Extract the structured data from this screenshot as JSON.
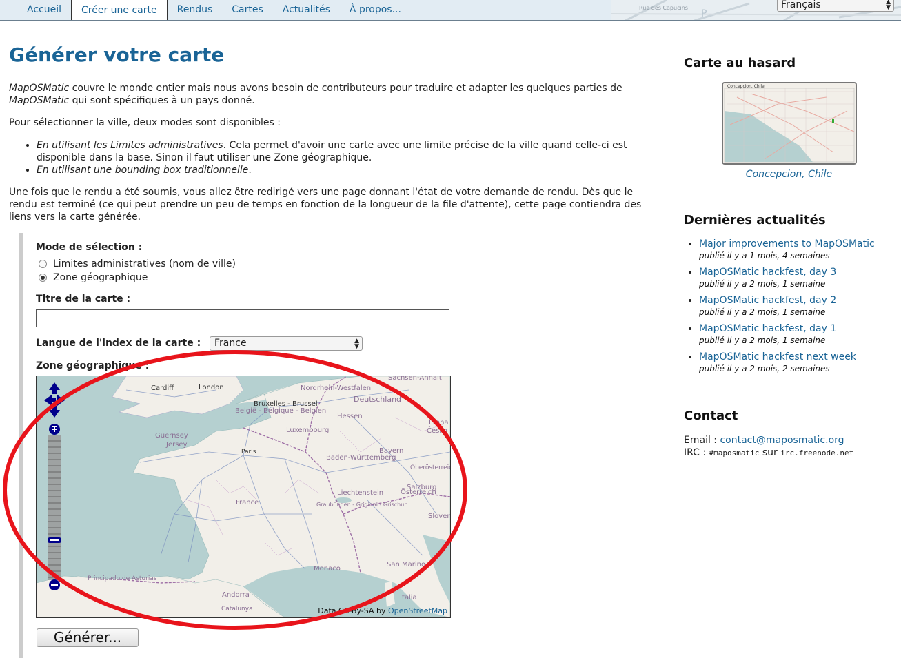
{
  "nav": {
    "tabs": [
      {
        "label": "Accueil"
      },
      {
        "label": "Créer une carte",
        "active": true
      },
      {
        "label": "Rendus"
      },
      {
        "label": "Cartes"
      },
      {
        "label": "Actualités"
      },
      {
        "label": "À propos..."
      }
    ],
    "language": "Français",
    "map_street_label": "Rue des Capucins"
  },
  "main": {
    "title": "Générer votre carte",
    "intro1_em": "MapOSMatic",
    "intro1_text": " couvre le monde entier mais nous avons besoin de contributeurs pour traduire et adapter les quelques parties de ",
    "intro1_em2": "MapOSMatic",
    "intro1_end": " qui sont spécifiques à un pays donné.",
    "intro2": "Pour sélectionner la ville, deux modes sont disponibles :",
    "mode1_em": "En utilisant les Limites administratives",
    "mode1_text": ". Cela permet d'avoir une carte avec une limite précise de la ville quand celle-ci est disponible dans la base. Sinon il faut utiliser une Zone géographique.",
    "mode2_em": "En utilisant une bounding box traditionnelle",
    "mode2_text": ".",
    "intro3": "Une fois que le rendu a été soumis, vous allez être redirigé vers une page donnant l'état de votre demande de rendu. Dès que le rendu est terminé (ce qui peut prendre un peu de temps en fonction de la longueur de la file d'attente), cette page contiendra des liens vers la carte générée."
  },
  "form": {
    "mode_label": "Mode de sélection :",
    "radio_admin": "Limites administratives (nom de ville)",
    "radio_zone": "Zone géographique",
    "selected_mode": "zone",
    "title_label": "Titre de la carte :",
    "title_value": "",
    "index_label": "Langue de l'index de la carte :",
    "index_value": "France",
    "zone_label": "Zone géographique :",
    "submit": "Générer..."
  },
  "map": {
    "labels": {
      "cardiff": "Cardiff",
      "london": "London",
      "bruxelles": "Bruxelles - Brussel",
      "belgie": "België - Belgique - Belgien",
      "nordrhein": "Nordrhein-Westfalen",
      "sachsen": "Sachsen-Anhalt",
      "deutschland": "Deutschland",
      "hessen": "Hessen",
      "luxembourg": "Luxembourg",
      "guernsey": "Guernsey",
      "jersey": "Jersey",
      "paris": "Paris",
      "bw": "Baden-Württemberg",
      "bayern": "Bayern",
      "praha": "Praha",
      "cesko": "Česko",
      "oberosterreich": "Oberösterreich",
      "salzburg": "Salzburg",
      "liechtenstein": "Liechtenstein",
      "osterreich": "Österreich",
      "graubunden": "Graubünden - Grigioni - Grischun",
      "france": "France",
      "slovenija": "Sloven",
      "monaco": "Monaco",
      "sanmarino": "San Marino",
      "asturias": "Principado de Asturias",
      "andorra": "Andorra",
      "catalunya": "Catalunya",
      "italia": "Italia"
    },
    "attribution_text": "Data CC-By-SA by ",
    "attribution_link": "OpenStreetMap"
  },
  "sidebar": {
    "random_heading": "Carte au hasard",
    "random_thumb_title": "Concepcion, Chile",
    "random_caption": "Concepcion, Chile",
    "news_heading": "Dernières actualités",
    "news": [
      {
        "title": "Major improvements to MapOSMatic",
        "date": "publié il y a 1 mois, 4 semaines"
      },
      {
        "title": "MapOSMatic hackfest, day 3",
        "date": "publié il y a 2 mois, 1 semaine"
      },
      {
        "title": "MapOSMatic hackfest, day 2",
        "date": "publié il y a 2 mois, 1 semaine"
      },
      {
        "title": "MapOSMatic hackfest, day 1",
        "date": "publié il y a 2 mois, 1 semaine"
      },
      {
        "title": "MapOSMatic hackfest next week",
        "date": "publié il y a 2 mois, 2 semaines"
      }
    ],
    "contact_heading": "Contact",
    "email_label": "Email : ",
    "email": "contact@maposmatic.org",
    "irc_label": "IRC : ",
    "irc_channel": "#maposmatic",
    "irc_sep": " sur ",
    "irc_server": "irc.freenode.net"
  },
  "colors": {
    "link": "#1a6496",
    "annotation": "#e8141b",
    "sea": "#b5d0d0",
    "land": "#f2efe9",
    "border": "#9e6fa6"
  }
}
